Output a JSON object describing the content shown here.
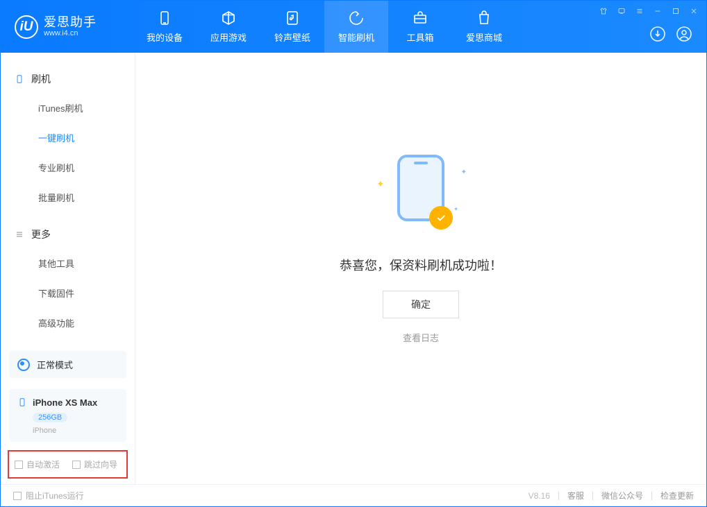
{
  "app": {
    "title": "爱思助手",
    "subtitle": "www.i4.cn",
    "logo_letter": "iU"
  },
  "tabs": [
    {
      "label": "我的设备",
      "icon": "device-icon"
    },
    {
      "label": "应用游戏",
      "icon": "apps-icon"
    },
    {
      "label": "铃声壁纸",
      "icon": "ringtone-icon"
    },
    {
      "label": "智能刷机",
      "icon": "flash-icon",
      "active": true
    },
    {
      "label": "工具箱",
      "icon": "toolbox-icon"
    },
    {
      "label": "爱思商城",
      "icon": "shop-icon"
    }
  ],
  "sidebar": {
    "group1_title": "刷机",
    "group1_items": [
      "iTunes刷机",
      "一键刷机",
      "专业刷机",
      "批量刷机"
    ],
    "group1_active_index": 1,
    "group2_title": "更多",
    "group2_items": [
      "其他工具",
      "下载固件",
      "高级功能"
    ]
  },
  "mode": {
    "label": "正常模式"
  },
  "device": {
    "name": "iPhone XS Max",
    "storage": "256GB",
    "type": "iPhone"
  },
  "options": {
    "auto_activate": "自动激活",
    "skip_guide": "跳过向导"
  },
  "main": {
    "message": "恭喜您，保资料刷机成功啦！",
    "ok_label": "确定",
    "log_label": "查看日志"
  },
  "footer": {
    "block_itunes": "阻止iTunes运行",
    "version": "V8.16",
    "support": "客服",
    "wechat": "微信公众号",
    "update": "检查更新"
  }
}
